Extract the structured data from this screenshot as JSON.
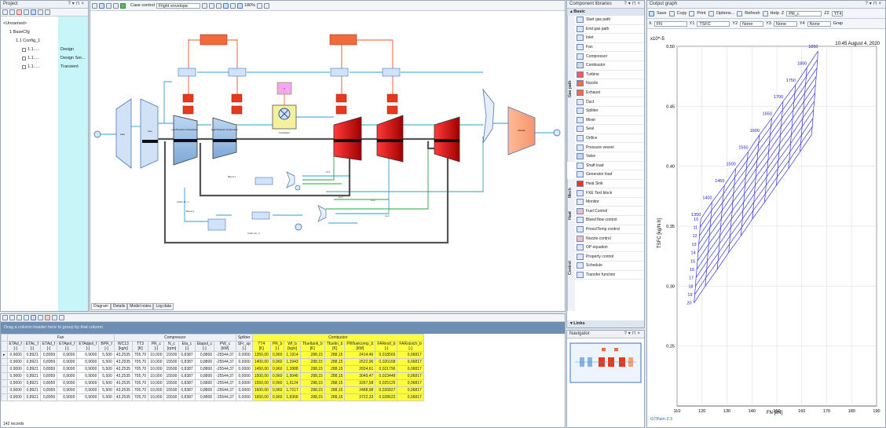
{
  "project": {
    "title": "Project",
    "tree": [
      {
        "label": "<Unnamed>",
        "indent": 0,
        "name_col": ""
      },
      {
        "label": "1 BaseCfg",
        "indent": 1,
        "name_col": ""
      },
      {
        "label": "1.1 Config_1",
        "indent": 2,
        "name_col": ""
      },
      {
        "label": "1.1.....",
        "indent": 3,
        "name_col": "Design"
      },
      {
        "label": "1.1.....",
        "indent": 3,
        "name_col": "Design Ser..."
      },
      {
        "label": "1.1.....",
        "indent": 3,
        "name_col": "Transient"
      }
    ]
  },
  "toolbar": {
    "case_label": "Case control",
    "case_value": "Flight envelope",
    "zoom": "180%"
  },
  "diagram": {
    "tabs": [
      "Diagram",
      "Details",
      "Model notes",
      "Log data"
    ],
    "components": {
      "inlet": "Inlet",
      "fan": "Fan",
      "lpc": "Low Pressure Compressor",
      "hpc": "High Pressure Compressor",
      "combustor": "Combustor",
      "nozzle": "Nozzle",
      "splitter": "Splitter"
    },
    "stations": [
      "1",
      "2",
      "13",
      "25",
      "3",
      "4",
      "41",
      "43",
      "45",
      "5",
      "6",
      "7",
      "8",
      "9",
      "BL"
    ],
    "bleeds": [
      "Bleed 1",
      "Bleed 2",
      "Cabin Air_1",
      "Cabin Air_2",
      "CL1",
      "CL2",
      "CL3",
      "CL4"
    ]
  },
  "library": {
    "title": "Component libraries",
    "header": "Basic",
    "groups": [
      "Gas path",
      "Mech",
      "Heat",
      "Control"
    ],
    "items": [
      "Start gas path",
      "End gas path",
      "Inlet",
      "Fan",
      "Compressor",
      "Combustor",
      "Turbine",
      "Nozzle",
      "Exhaust",
      "Duct",
      "Splitter",
      "Mixer",
      "Seal",
      "Orifice",
      "Pressure vessel",
      "Valve",
      "Shaft load",
      "Generator load",
      "Heat Sink",
      "FXE Text block",
      "Monitor",
      "Fuel Control",
      "Bleed flow control",
      "Press/Temp control",
      "Nozzle control",
      "OP equation",
      "Property control",
      "Schedule",
      "Transfer function"
    ],
    "footer": "Links"
  },
  "navigator": {
    "title": "Navigator"
  },
  "output": {
    "title": "Output graph",
    "save": "Save",
    "copy": "Copy",
    "print": "Print",
    "options": "Options...",
    "refresh": "Refresh",
    "help": "Help",
    "z": "PR_c",
    "z2_label": "Z2",
    "z2": "TT4",
    "x": "FN",
    "y1": "TSFC",
    "y2": "None",
    "y3": "None",
    "y4": "None",
    "gra": "Grap",
    "timestamp": "10:45  August 4, 2020",
    "footer": "GTPam 2.3"
  },
  "chart_data": {
    "type": "line",
    "title": "",
    "xlabel": "FN [kN]",
    "ylabel": "TSFC [kg/N h]",
    "yscale_note": "x10^-5",
    "xlim": [
      110,
      190
    ],
    "ylim": [
      0.2,
      0.5
    ],
    "xticks": [
      110,
      120,
      130,
      140,
      150,
      160,
      170,
      180,
      190
    ],
    "yticks": [
      0.25,
      0.3,
      0.35,
      0.4,
      0.45,
      0.5
    ],
    "ytick_labels": [
      "0.25",
      "0.30",
      "0.35",
      "0.40",
      "0.45",
      "0.50"
    ],
    "grid": true,
    "tt4_labels": [
      "1350",
      "1400",
      "1450",
      "1500",
      "1550",
      "1600",
      "1650",
      "1700",
      "1750",
      "1800",
      "1850"
    ],
    "pr_labels": [
      "10",
      "11",
      "12",
      "13",
      "14",
      "15",
      "16",
      "17",
      "18",
      "19",
      "20"
    ],
    "fn_grid": [
      [
        119.5,
        124,
        129,
        133.5,
        138.5,
        143,
        148,
        152.5,
        157.5,
        162,
        166.5
      ],
      [
        119.2,
        123.8,
        128.6,
        133.2,
        138.1,
        142.7,
        147.6,
        152.3,
        157.2,
        161.8,
        166.3
      ],
      [
        119,
        123.5,
        128.3,
        132.9,
        137.8,
        142.4,
        147.3,
        152,
        156.9,
        161.5,
        166.1
      ],
      [
        118.7,
        123.2,
        128,
        132.6,
        137.5,
        142.1,
        147,
        151.7,
        156.6,
        161.2,
        165.8
      ],
      [
        118.4,
        122.9,
        127.7,
        132.3,
        137.2,
        141.8,
        146.7,
        151.4,
        156.3,
        160.9,
        165.5
      ],
      [
        118.2,
        122.7,
        127.5,
        132.1,
        137,
        141.6,
        146.5,
        151.2,
        156.1,
        160.7,
        165.3
      ],
      [
        117.9,
        122.4,
        127.2,
        131.8,
        136.7,
        141.3,
        146.2,
        150.9,
        155.8,
        160.4,
        165
      ],
      [
        117.6,
        122.1,
        126.9,
        131.5,
        136.4,
        141,
        145.9,
        150.6,
        155.5,
        160.1,
        164.7
      ],
      [
        117.4,
        121.9,
        126.7,
        131.3,
        136.2,
        140.8,
        145.7,
        150.4,
        155.3,
        159.9,
        164.5
      ],
      [
        117.1,
        121.6,
        126.4,
        131,
        135.9,
        140.5,
        145.4,
        150.1,
        155,
        159.6,
        164.2
      ],
      [
        116.8,
        121.3,
        126.1,
        130.7,
        135.6,
        140.2,
        145.1,
        149.8,
        154.7,
        159.3,
        163.9
      ]
    ],
    "tsfc_grid": [
      [
        0.356,
        0.37,
        0.384,
        0.398,
        0.412,
        0.426,
        0.44,
        0.454,
        0.468,
        0.482,
        0.496
      ],
      [
        0.349,
        0.363,
        0.377,
        0.391,
        0.405,
        0.419,
        0.433,
        0.447,
        0.461,
        0.475,
        0.489
      ],
      [
        0.342,
        0.356,
        0.37,
        0.384,
        0.398,
        0.412,
        0.426,
        0.44,
        0.454,
        0.468,
        0.482
      ],
      [
        0.335,
        0.349,
        0.363,
        0.377,
        0.391,
        0.405,
        0.419,
        0.433,
        0.447,
        0.461,
        0.475
      ],
      [
        0.328,
        0.342,
        0.356,
        0.37,
        0.384,
        0.398,
        0.412,
        0.426,
        0.44,
        0.454,
        0.468
      ],
      [
        0.321,
        0.335,
        0.349,
        0.363,
        0.377,
        0.391,
        0.405,
        0.419,
        0.433,
        0.447,
        0.461
      ],
      [
        0.314,
        0.328,
        0.342,
        0.356,
        0.37,
        0.384,
        0.398,
        0.412,
        0.426,
        0.44,
        0.454
      ],
      [
        0.307,
        0.321,
        0.335,
        0.349,
        0.363,
        0.377,
        0.391,
        0.405,
        0.419,
        0.433,
        0.447
      ],
      [
        0.3,
        0.314,
        0.328,
        0.342,
        0.356,
        0.37,
        0.384,
        0.398,
        0.412,
        0.426,
        0.44
      ],
      [
        0.293,
        0.307,
        0.321,
        0.335,
        0.349,
        0.363,
        0.377,
        0.391,
        0.405,
        0.419,
        0.433
      ],
      [
        0.286,
        0.3,
        0.314,
        0.328,
        0.342,
        0.356,
        0.37,
        0.384,
        0.398,
        0.412,
        0.426
      ]
    ]
  },
  "table": {
    "group_hint": "Drag a column header here to group by that column",
    "record_count": "142 records",
    "groups": [
      {
        "label": "Fan",
        "span": 6,
        "yellow": false
      },
      {
        "label": "Compressor",
        "span": 7,
        "yellow": false
      },
      {
        "label": "Splitter",
        "span": 1,
        "yellow": false
      },
      {
        "label": "Combustor",
        "span": 8,
        "yellow": true
      }
    ],
    "columns": [
      {
        "name": "ETAd_f",
        "unit": "[-]"
      },
      {
        "name": "ETAc_f",
        "unit": "[-]"
      },
      {
        "name": "ETAd_f",
        "unit": "[-]"
      },
      {
        "name": "ETApol_f",
        "unit": "[-]"
      },
      {
        "name": "ETAdpol_f",
        "unit": "[-]"
      },
      {
        "name": "BPR_f",
        "unit": "[-]"
      },
      {
        "name": "WC13",
        "unit": "[kg/s]"
      },
      {
        "name": "TT3",
        "unit": "[K]"
      },
      {
        "name": "PR_c",
        "unit": "[-]"
      },
      {
        "name": "N_c",
        "unit": "[rpm]"
      },
      {
        "name": "Eta_c",
        "unit": "[-]"
      },
      {
        "name": "Etapol_c",
        "unit": "[-]"
      },
      {
        "name": "PW_c",
        "unit": "[kW]"
      },
      {
        "name": "SFr_sp",
        "unit": "[-]"
      },
      {
        "name": "TT4",
        "unit": "[K]"
      },
      {
        "name": "PR_b",
        "unit": "[-]"
      },
      {
        "name": "Wf_b",
        "unit": "[kg/s]"
      },
      {
        "name": "Tfueltank_b",
        "unit": "[K]"
      },
      {
        "name": "Tfuelin_b",
        "unit": "[K]"
      },
      {
        "name": "PWfuelcomp_b",
        "unit": "[kW]"
      },
      {
        "name": "FARexit_b",
        "unit": "[-]"
      },
      {
        "name": "FARstoich_b",
        "unit": "[-]"
      }
    ],
    "rows": [
      [
        "0,9000",
        "0,8921",
        "0,8959",
        "0,9000",
        "0,9000",
        "5,500",
        "43,2535",
        "705,70",
        "10,000",
        "15500",
        "0,8387",
        "0,8800",
        "-25544,37",
        "0,0000",
        "1350,00",
        "0,960",
        "1,1914",
        "288,15",
        "288,15",
        "2414,46",
        "0,018565",
        "0,06817"
      ],
      [
        "0,9000",
        "0,8921",
        "0,8959",
        "0,9000",
        "0,9000",
        "5,500",
        "43,2535",
        "705,70",
        "10,000",
        "15500",
        "0,8387",
        "0,8800",
        "-25544,37",
        "0,0000",
        "1400,00",
        "0,960",
        "1,2943",
        "288,15",
        "288,15",
        "2622,96",
        "0,020168",
        "0,06817"
      ],
      [
        "0,9000",
        "0,8921",
        "0,8959",
        "0,9000",
        "0,9000",
        "5,500",
        "43,2535",
        "705,70",
        "10,000",
        "15500",
        "0,8387",
        "0,8800",
        "-25544,37",
        "0,0000",
        "1450,00",
        "0,960",
        "1,3988",
        "288,15",
        "288,15",
        "2834,61",
        "0,021796",
        "0,06817"
      ],
      [
        "0,9000",
        "0,8921",
        "0,8959",
        "0,9000",
        "0,9000",
        "5,500",
        "43,2535",
        "705,70",
        "10,000",
        "15500",
        "0,8387",
        "0,8800",
        "-25544,37",
        "0,0000",
        "1500,00",
        "0,960",
        "1,5046",
        "288,15",
        "288,15",
        "3049,47",
        "0,023448",
        "0,06817"
      ],
      [
        "0,9000",
        "0,8921",
        "0,8959",
        "0,9000",
        "0,9000",
        "5,500",
        "43,2535",
        "705,70",
        "10,000",
        "15500",
        "0,8387",
        "0,8800",
        "-25544,37",
        "0,0000",
        "1550,00",
        "0,960",
        "1,6124",
        "288,15",
        "288,15",
        "3267,58",
        "0,025125",
        "0,06817"
      ],
      [
        "0,9000",
        "0,8921",
        "0,8959",
        "0,9000",
        "0,9000",
        "5,500",
        "43,2535",
        "705,70",
        "10,000",
        "15500",
        "0,8387",
        "0,8800",
        "-25544,37",
        "0,0000",
        "1600,00",
        "0,960",
        "1,7217",
        "288,15",
        "288,15",
        "3488,98",
        "0,026827",
        "0,06817"
      ],
      [
        "0,9000",
        "0,8921",
        "0,8959",
        "0,9000",
        "0,9000",
        "5,500",
        "43,2535",
        "705,70",
        "10,000",
        "15500",
        "0,8387",
        "0,8800",
        "-25544,37",
        "0,0000",
        "1650,00",
        "0,960",
        "1,8368",
        "288,15",
        "288,15",
        "3722,33",
        "0,028622",
        "0,06817"
      ]
    ]
  }
}
